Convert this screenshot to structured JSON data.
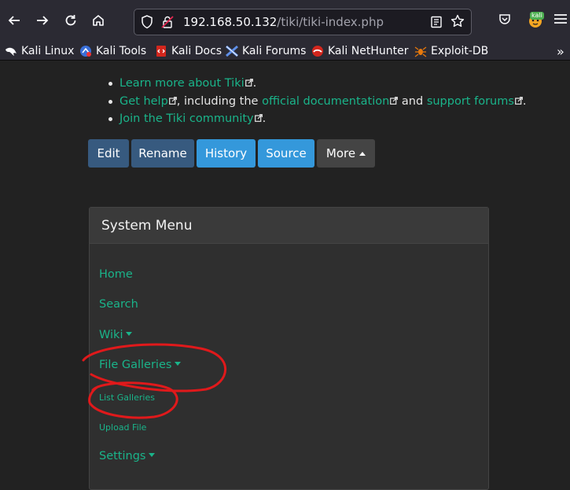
{
  "browser": {
    "url_host": "192.168.50.132",
    "url_path": "/tiki/tiki-index.php",
    "profile_badge": "kali",
    "bookmarks": [
      "Kali Linux",
      "Kali Tools",
      "Kali Docs",
      "Kali Forums",
      "Kali NetHunter",
      "Exploit-DB"
    ]
  },
  "content": {
    "links": [
      {
        "link": "Learn more about Tiki",
        "after": "."
      },
      {
        "link": "Get help",
        "after": ", including the ",
        "link2": "official documentation",
        "after2": " and ",
        "link3": "support forums",
        "after3": "."
      },
      {
        "link": "Join the Tiki community",
        "after": "."
      }
    ],
    "buttons": {
      "edit": "Edit",
      "rename": "Rename",
      "history": "History",
      "source": "Source",
      "more": "More"
    }
  },
  "menu": {
    "title": "System Menu",
    "items": [
      "Home",
      "Search",
      "Wiki",
      "File Galleries",
      "List Galleries",
      "Upload File",
      "Settings"
    ]
  },
  "colors": {
    "link": "#1ab48a",
    "btn_dark_blue": "#375a7f",
    "btn_light_blue": "#3498db",
    "btn_gray": "#444444",
    "annotation": "#e0191b"
  }
}
